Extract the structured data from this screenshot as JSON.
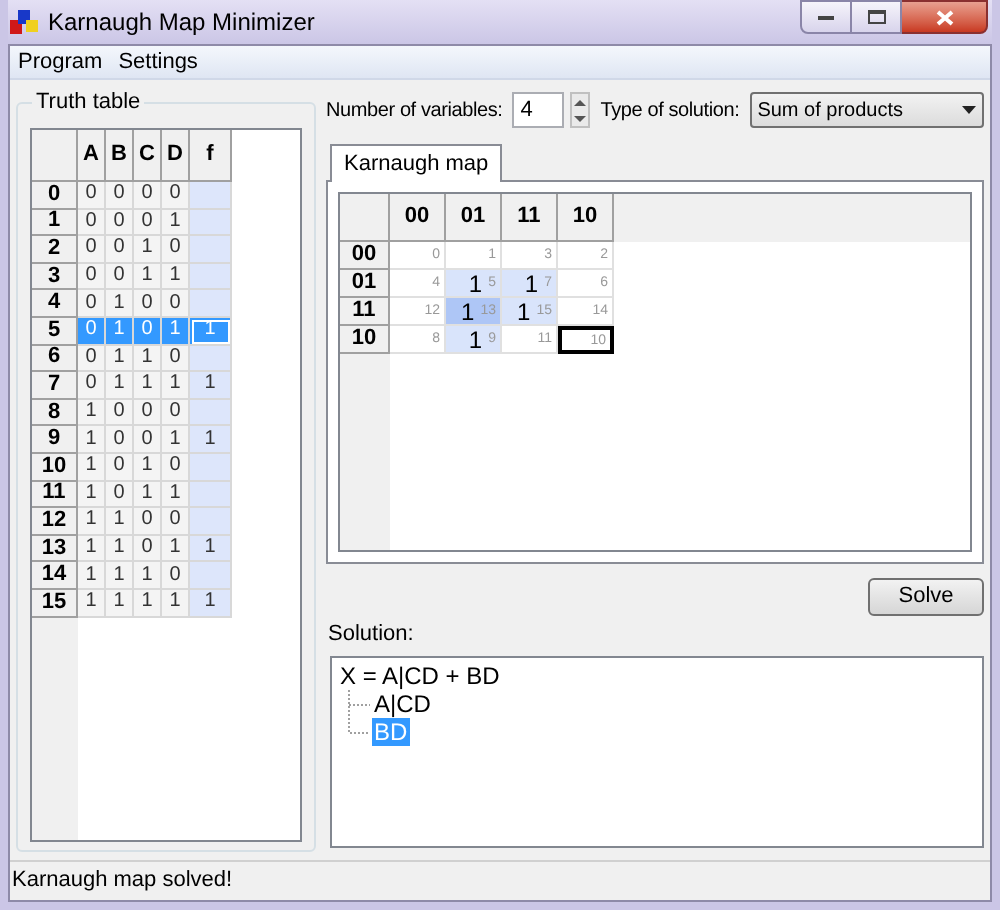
{
  "window": {
    "title": "Karnaugh Map Minimizer"
  },
  "menu": [
    {
      "label": "Program"
    },
    {
      "label": "Settings"
    }
  ],
  "truth_table": {
    "title": "Truth table",
    "columns": [
      "A",
      "B",
      "C",
      "D",
      "f"
    ],
    "rows": [
      {
        "index": "0",
        "values": [
          "0",
          "0",
          "0",
          "0"
        ],
        "selected": false
      },
      {
        "index": "1",
        "values": [
          "0",
          "0",
          "0",
          "1"
        ],
        "selected": false
      },
      {
        "index": "2",
        "values": [
          "0",
          "0",
          "1",
          "0"
        ],
        "selected": false
      },
      {
        "index": "3",
        "values": [
          "0",
          "0",
          "1",
          "1"
        ],
        "selected": false
      },
      {
        "index": "4",
        "values": [
          "0",
          "1",
          "0",
          "0"
        ],
        "selected": false
      },
      {
        "index": "5",
        "values": [
          "0",
          "1",
          "0",
          "1"
        ],
        "f": "1",
        "selected": true
      },
      {
        "index": "6",
        "values": [
          "0",
          "1",
          "1",
          "0"
        ],
        "selected": false
      },
      {
        "index": "7",
        "values": [
          "0",
          "1",
          "1",
          "1"
        ],
        "f": "1",
        "selected": false
      },
      {
        "index": "8",
        "values": [
          "1",
          "0",
          "0",
          "0"
        ],
        "selected": false
      },
      {
        "index": "9",
        "values": [
          "1",
          "0",
          "0",
          "1"
        ],
        "f": "1",
        "selected": false
      },
      {
        "index": "10",
        "values": [
          "1",
          "0",
          "1",
          "0"
        ],
        "selected": false
      },
      {
        "index": "11",
        "values": [
          "1",
          "0",
          "1",
          "1"
        ],
        "selected": false
      },
      {
        "index": "12",
        "values": [
          "1",
          "1",
          "0",
          "0"
        ],
        "selected": false
      },
      {
        "index": "13",
        "values": [
          "1",
          "1",
          "0",
          "1"
        ],
        "f": "1",
        "selected": false
      },
      {
        "index": "14",
        "values": [
          "1",
          "1",
          "1",
          "0"
        ],
        "selected": false
      },
      {
        "index": "15",
        "values": [
          "1",
          "1",
          "1",
          "1"
        ],
        "f": "1",
        "selected": false
      }
    ]
  },
  "variables": {
    "label": "Number of variables:",
    "value": "4"
  },
  "solution_type": {
    "label": "Type of solution:",
    "value": "Sum of products"
  },
  "tabs": [
    {
      "label": "Karnaugh map",
      "selected": true
    }
  ],
  "kmap": {
    "columns": [
      "00",
      "01",
      "11",
      "10"
    ],
    "rows": [
      {
        "label": "00",
        "cells": [
          {
            "minterm": "0",
            "in_group": false,
            "selected": false,
            "focused": false
          },
          {
            "minterm": "1",
            "in_group": false,
            "selected": false,
            "focused": false
          },
          {
            "minterm": "3",
            "in_group": false,
            "selected": false,
            "focused": false
          },
          {
            "minterm": "2",
            "in_group": false,
            "selected": false,
            "focused": false
          }
        ]
      },
      {
        "label": "01",
        "cells": [
          {
            "minterm": "4",
            "in_group": false,
            "selected": false,
            "focused": false
          },
          {
            "value": "1",
            "minterm": "5",
            "in_group": true,
            "selected": false,
            "focused": false
          },
          {
            "value": "1",
            "minterm": "7",
            "in_group": true,
            "selected": false,
            "focused": false
          },
          {
            "minterm": "6",
            "in_group": false,
            "selected": false,
            "focused": false
          }
        ]
      },
      {
        "label": "11",
        "cells": [
          {
            "minterm": "12",
            "in_group": false,
            "selected": false,
            "focused": false
          },
          {
            "value": "1",
            "minterm": "13",
            "in_group": true,
            "selected": true,
            "focused": false
          },
          {
            "value": "1",
            "minterm": "15",
            "in_group": true,
            "selected": false,
            "focused": false
          },
          {
            "minterm": "14",
            "in_group": false,
            "selected": false,
            "focused": false
          }
        ]
      },
      {
        "label": "10",
        "cells": [
          {
            "minterm": "8",
            "in_group": false,
            "selected": false,
            "focused": false
          },
          {
            "value": "1",
            "minterm": "9",
            "in_group": true,
            "selected": false,
            "focused": false
          },
          {
            "minterm": "11",
            "in_group": false,
            "selected": false,
            "focused": false
          },
          {
            "minterm": "10",
            "in_group": false,
            "selected": false,
            "focused": true
          }
        ]
      }
    ]
  },
  "solve_button": "Solve",
  "solution": {
    "label": "Solution:",
    "tree": {
      "text": "X = A|CD + BD",
      "expanded": true,
      "selected": false,
      "children": [
        {
          "text": "A|CD",
          "selected": false
        },
        {
          "text": "BD",
          "selected": true
        }
      ]
    }
  },
  "status_bar": "Karnaugh map solved!"
}
